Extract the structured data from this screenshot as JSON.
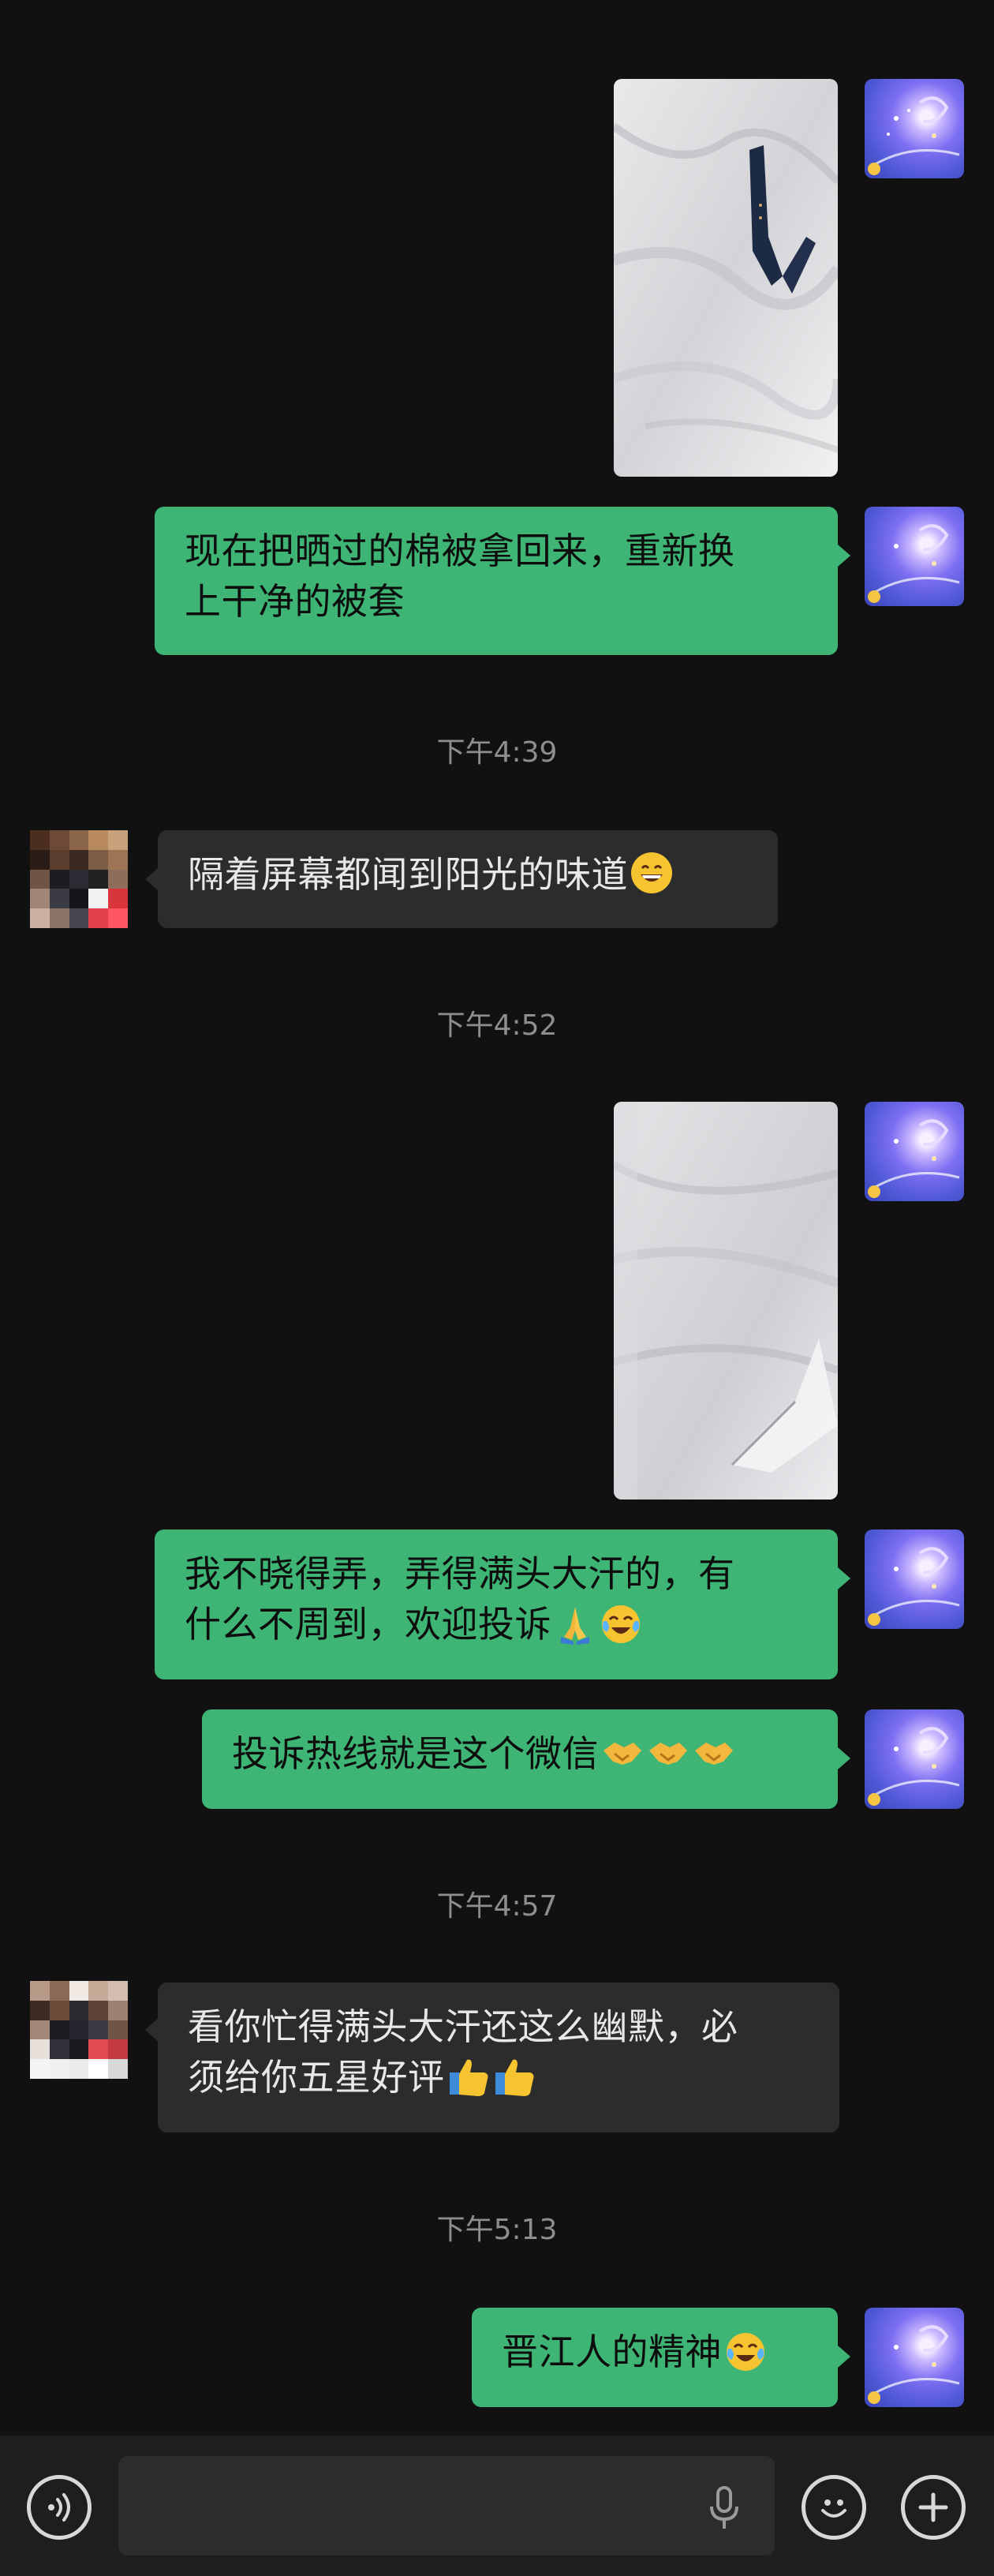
{
  "messages": [
    {
      "type": "image",
      "sender": "me",
      "description": "photo"
    },
    {
      "type": "text",
      "sender": "me",
      "text_line1": "现在把晒过的棉被拿回来，重新换",
      "text_line2": "上干净的被套"
    },
    {
      "type": "time",
      "text": "下午4:39"
    },
    {
      "type": "text",
      "sender": "other",
      "text": "隔着屏幕都闻到阳光的味道"
    },
    {
      "type": "time",
      "text": "下午4:52"
    },
    {
      "type": "image",
      "sender": "me",
      "description": "photo"
    },
    {
      "type": "text",
      "sender": "me",
      "text_line1": "我不晓得弄，弄得满头大汗的，有",
      "text_line2": "什么不周到，欢迎投诉"
    },
    {
      "type": "text",
      "sender": "me",
      "text": "投诉热线就是这个微信"
    },
    {
      "type": "time",
      "text": "下午4:57"
    },
    {
      "type": "text",
      "sender": "other",
      "text_line1": "看你忙得满头大汗还这么幽默，必",
      "text_line2": "须给你五星好评"
    },
    {
      "type": "time",
      "text": "下午5:13"
    },
    {
      "type": "text",
      "sender": "me",
      "text": "晋江人的精神"
    }
  ],
  "emojis": {
    "grin": "grin-emoji",
    "pray": "pray-emoji",
    "laugh_cry": "laugh-cry-emoji",
    "handshake": "handshake-emoji",
    "thumbs_up": "thumbs-up-emoji"
  },
  "input_bar": {
    "placeholder": "",
    "icons": [
      "voice-icon",
      "microphone-icon",
      "emoji-icon",
      "plus-icon"
    ]
  }
}
